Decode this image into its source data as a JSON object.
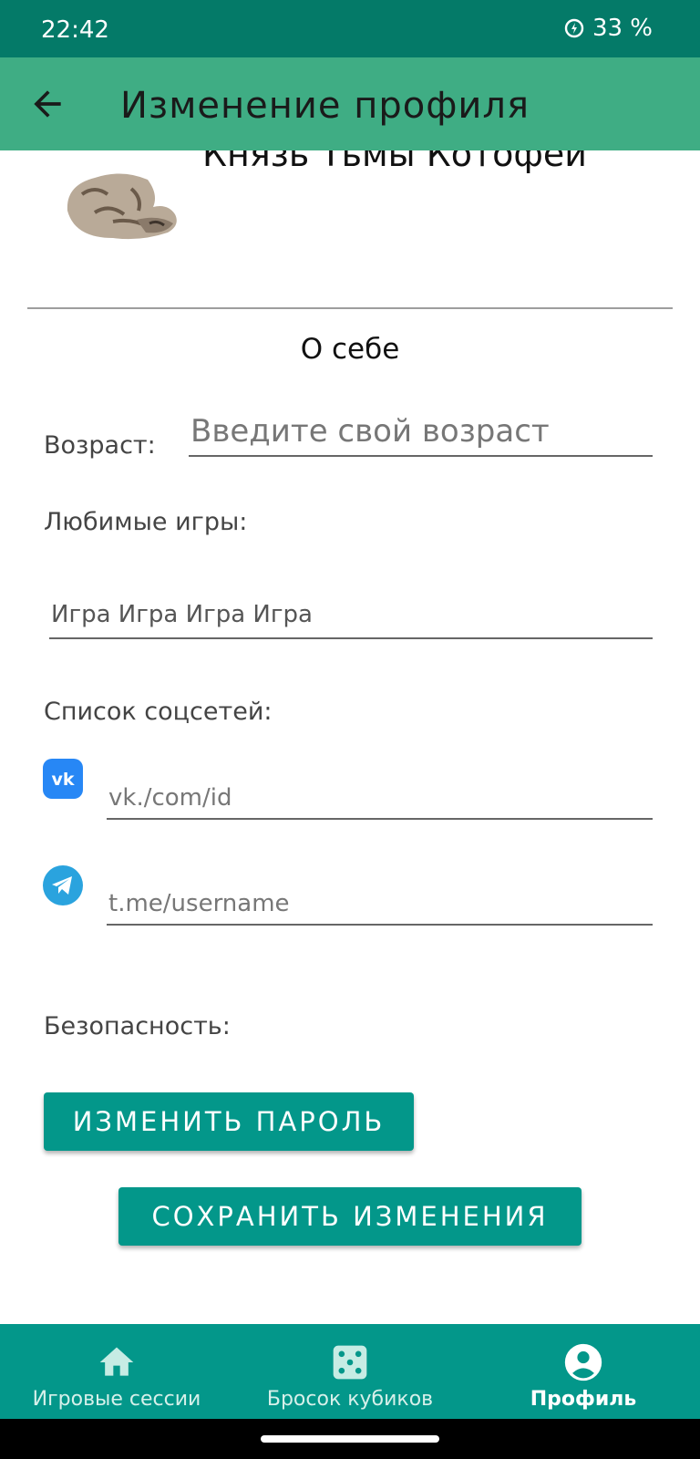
{
  "status_bar": {
    "time": "22:42",
    "battery": "33 %"
  },
  "app_bar": {
    "title": "Изменение профиля",
    "back_icon": "arrow-left-icon"
  },
  "profile": {
    "name": "Князь Тьмы Котофей"
  },
  "about": {
    "title": "О себе",
    "age_label": "Возраст:",
    "age_placeholder": "Введите свой возраст",
    "games_label": "Любимые игры:",
    "games_value": "Игра Игра Игра Игра",
    "social_label": "Список соцсетей:",
    "vk_placeholder": "vk./com/id",
    "tg_placeholder": "t.me/username",
    "security_label": "Безопасность:"
  },
  "buttons": {
    "change_password": "ИЗМЕНИТЬ ПАРОЛЬ",
    "save_changes": "СОХРАНИТЬ ИЗМЕНЕНИЯ"
  },
  "bottom_nav": {
    "items": [
      {
        "label": "Игровые сессии",
        "icon": "home-icon"
      },
      {
        "label": "Бросок кубиков",
        "icon": "dice-icon"
      },
      {
        "label": "Профиль",
        "icon": "profile-icon"
      }
    ]
  },
  "colors": {
    "status_bar": "#047a68",
    "app_bar": "#3fad84",
    "accent": "#03978a"
  }
}
